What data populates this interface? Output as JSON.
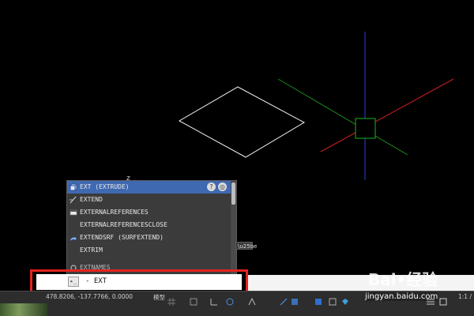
{
  "autocomplete": {
    "items": [
      {
        "label": "EXT (EXTRUDE)",
        "icon": "extrude-icon",
        "selected": true
      },
      {
        "label": "EXTEND",
        "icon": "extend-icon",
        "selected": false
      },
      {
        "label": "EXTERNALREFERENCES",
        "icon": "xref-palette-icon",
        "selected": false
      },
      {
        "label": "EXTERNALREFERENCESCLOSE",
        "icon": "",
        "selected": false
      },
      {
        "label": "EXTENDSRF (SURFEXTEND)",
        "icon": "surface-extend-icon",
        "selected": false
      },
      {
        "label": "EXTRIM",
        "icon": "",
        "selected": false
      },
      {
        "label": "EXTNAMES",
        "icon": "gear-icon",
        "selected": false
      }
    ],
    "help_glyph": "?",
    "web_glyph": "◎"
  },
  "command_line": {
    "close_glyph": "✕",
    "customize_glyph": "🔧",
    "prompt_glyph": "▸_",
    "input_value": "- EXT"
  },
  "status_bar": {
    "coordinates": "478.8206, -137.7766, 0.0000",
    "model_label": "模型",
    "scale": "1:1 /"
  },
  "watermark": {
    "logo_text": "Bai•经验",
    "url": "jingyan.baidu.com"
  },
  "drawing": {
    "crosshair_x_color": "#d02020",
    "crosshair_y_color": "#2a3fdc",
    "crosshair_z_color": "#1d8a1d",
    "pickbox_color": "#19b319",
    "shape_color": "#f2f2f2"
  }
}
